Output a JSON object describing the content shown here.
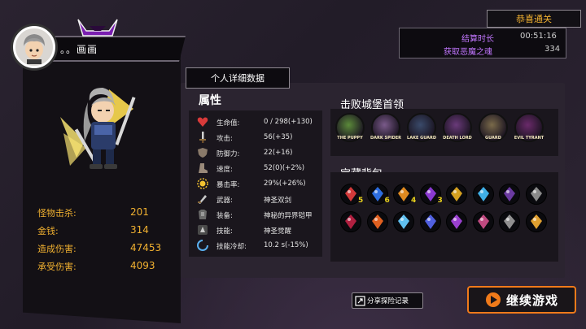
{
  "player": {
    "name": "。。画画"
  },
  "stats": [
    {
      "label": "怪物击杀:",
      "value": "201"
    },
    {
      "label": "金钱:",
      "value": "314"
    },
    {
      "label": "造成伤害:",
      "value": "47453"
    },
    {
      "label": "承受伤害:",
      "value": "4093"
    }
  ],
  "detail_tab": "个人详细数据",
  "attributes": {
    "title": "属性",
    "rows": [
      {
        "icon": "heart-icon",
        "label": "生命值:",
        "value": "0 / 298(+130)"
      },
      {
        "icon": "sword-icon",
        "label": "攻击:",
        "value": "56(+35)"
      },
      {
        "icon": "shield-icon",
        "label": "防御力:",
        "value": "22(+16)"
      },
      {
        "icon": "boot-icon",
        "label": "速度:",
        "value": "52(0)(+2%)"
      },
      {
        "icon": "sun-icon",
        "label": "暴击率:",
        "value": "29%(+26%)"
      },
      {
        "icon": "weapon-icon",
        "label": "武器:",
        "value": "神圣双剑"
      },
      {
        "icon": "armor-icon",
        "label": "装备:",
        "value": "神秘的异界铠甲"
      },
      {
        "icon": "skill-icon",
        "label": "技能:",
        "value": "神圣觉醒"
      },
      {
        "icon": "cooldown-icon",
        "label": "技能冷却:",
        "value": "10.2 s(-15%)"
      }
    ]
  },
  "bosses": {
    "title": "击败城堡首领",
    "items": [
      {
        "label": "THE PUPPY",
        "color": "#5b8a3a"
      },
      {
        "label": "DARK SPIDER",
        "color": "#7a5a8a"
      },
      {
        "label": "LAKE GUARD",
        "color": "#3a4a6a"
      },
      {
        "label": "DEATH LORD",
        "color": "#6a3a7a"
      },
      {
        "label": "GUARD",
        "color": "#7a6a4a"
      },
      {
        "label": "EVIL TYRANT",
        "color": "#6a2a6a"
      }
    ]
  },
  "bag": {
    "title": "宝藏背包",
    "items": [
      {
        "icon": "red-crystal-icon",
        "color": "#d23a3a",
        "count": "5"
      },
      {
        "icon": "blue-orb-icon",
        "color": "#2e6ee0",
        "count": "6"
      },
      {
        "icon": "amber-gem-icon",
        "color": "#e08a20",
        "count": "4"
      },
      {
        "icon": "purple-gem-icon",
        "color": "#8a3ad0",
        "count": "3"
      },
      {
        "icon": "gold-gauntlet-icon",
        "color": "#d4a020",
        "count": ""
      },
      {
        "icon": "ice-flower-icon",
        "color": "#40b0e8",
        "count": ""
      },
      {
        "icon": "dark-rune-icon",
        "color": "#6a3aa0",
        "count": ""
      },
      {
        "icon": "chain-icon",
        "color": "#8a8a8a",
        "count": ""
      },
      {
        "icon": "crimson-orb-icon",
        "color": "#b02040",
        "count": ""
      },
      {
        "icon": "fire-burst-icon",
        "color": "#e06020",
        "count": ""
      },
      {
        "icon": "ice-shard-icon",
        "color": "#60c0f0",
        "count": ""
      },
      {
        "icon": "lightning-icon",
        "color": "#5060e0",
        "count": ""
      },
      {
        "icon": "purple-blade-icon",
        "color": "#9a40d0",
        "count": ""
      },
      {
        "icon": "demon-mask-icon",
        "color": "#c04a80",
        "count": ""
      },
      {
        "icon": "rune-circle-icon",
        "color": "#909090",
        "count": ""
      },
      {
        "icon": "gold-sun-icon",
        "color": "#e0a030",
        "count": ""
      }
    ]
  },
  "summary": {
    "title": "恭喜通关",
    "rows": [
      {
        "label": "结算时长",
        "value": "00:51:16"
      },
      {
        "label": "获取恶魔之魂",
        "value": "334"
      }
    ]
  },
  "buttons": {
    "share": "分享探险记录",
    "continue": "继续游戏"
  },
  "colors": {
    "accent_orange": "#f07a1a",
    "stat_gold": "#f0b030",
    "soul_purple": "#c277ff"
  }
}
